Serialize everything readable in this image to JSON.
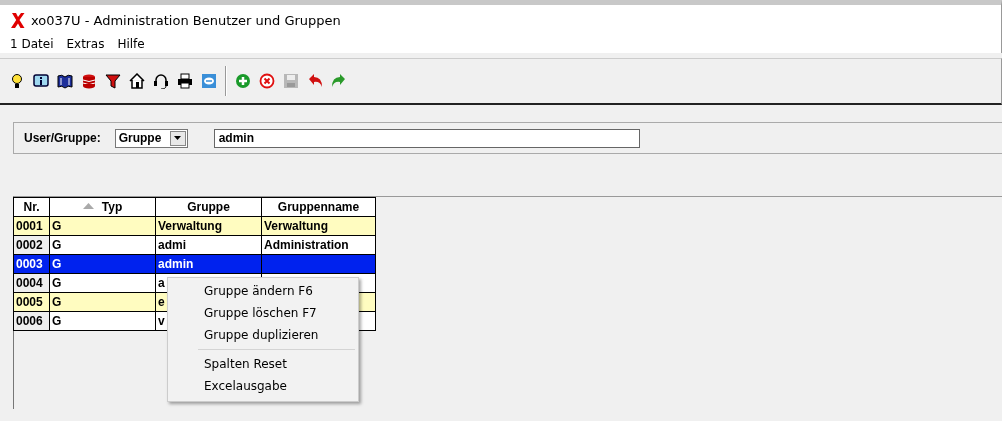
{
  "window": {
    "title": "xo037U - Administration Benutzer und Gruppen"
  },
  "menu": [
    "1 Datei",
    "Extras",
    "Hilfe"
  ],
  "filter": {
    "label": "User/Gruppe:",
    "type_value": "Gruppe",
    "search_value": "admin"
  },
  "table": {
    "columns": [
      {
        "label": "Nr.",
        "sorted": false
      },
      {
        "label": "Typ",
        "sorted": true
      },
      {
        "label": "Gruppe",
        "sorted": false
      },
      {
        "label": "Gruppenname",
        "sorted": false
      }
    ],
    "rows": [
      {
        "cells": [
          "0001",
          "G",
          "Verwaltung",
          "Verwaltung"
        ],
        "marked": true,
        "selected": false
      },
      {
        "cells": [
          "0002",
          "G",
          "admi",
          "Administration"
        ],
        "marked": false,
        "selected": false
      },
      {
        "cells": [
          "0003",
          "G",
          "admin"
        ],
        "marked": false,
        "selected": true
      },
      {
        "cells": [
          "0004",
          "G",
          "a"
        ],
        "marked": false,
        "selected": false
      },
      {
        "cells": [
          "0005",
          "G",
          "e"
        ],
        "marked": true,
        "selected": false
      },
      {
        "cells": [
          "0006",
          "G",
          "v"
        ],
        "marked": false,
        "selected": false
      }
    ]
  },
  "context_menu": {
    "groups": [
      [
        "Gruppe ändern F6",
        "Gruppe löschen F7",
        "Gruppe duplizieren"
      ],
      [
        "Spalten Reset",
        "Excelausgabe"
      ]
    ]
  }
}
